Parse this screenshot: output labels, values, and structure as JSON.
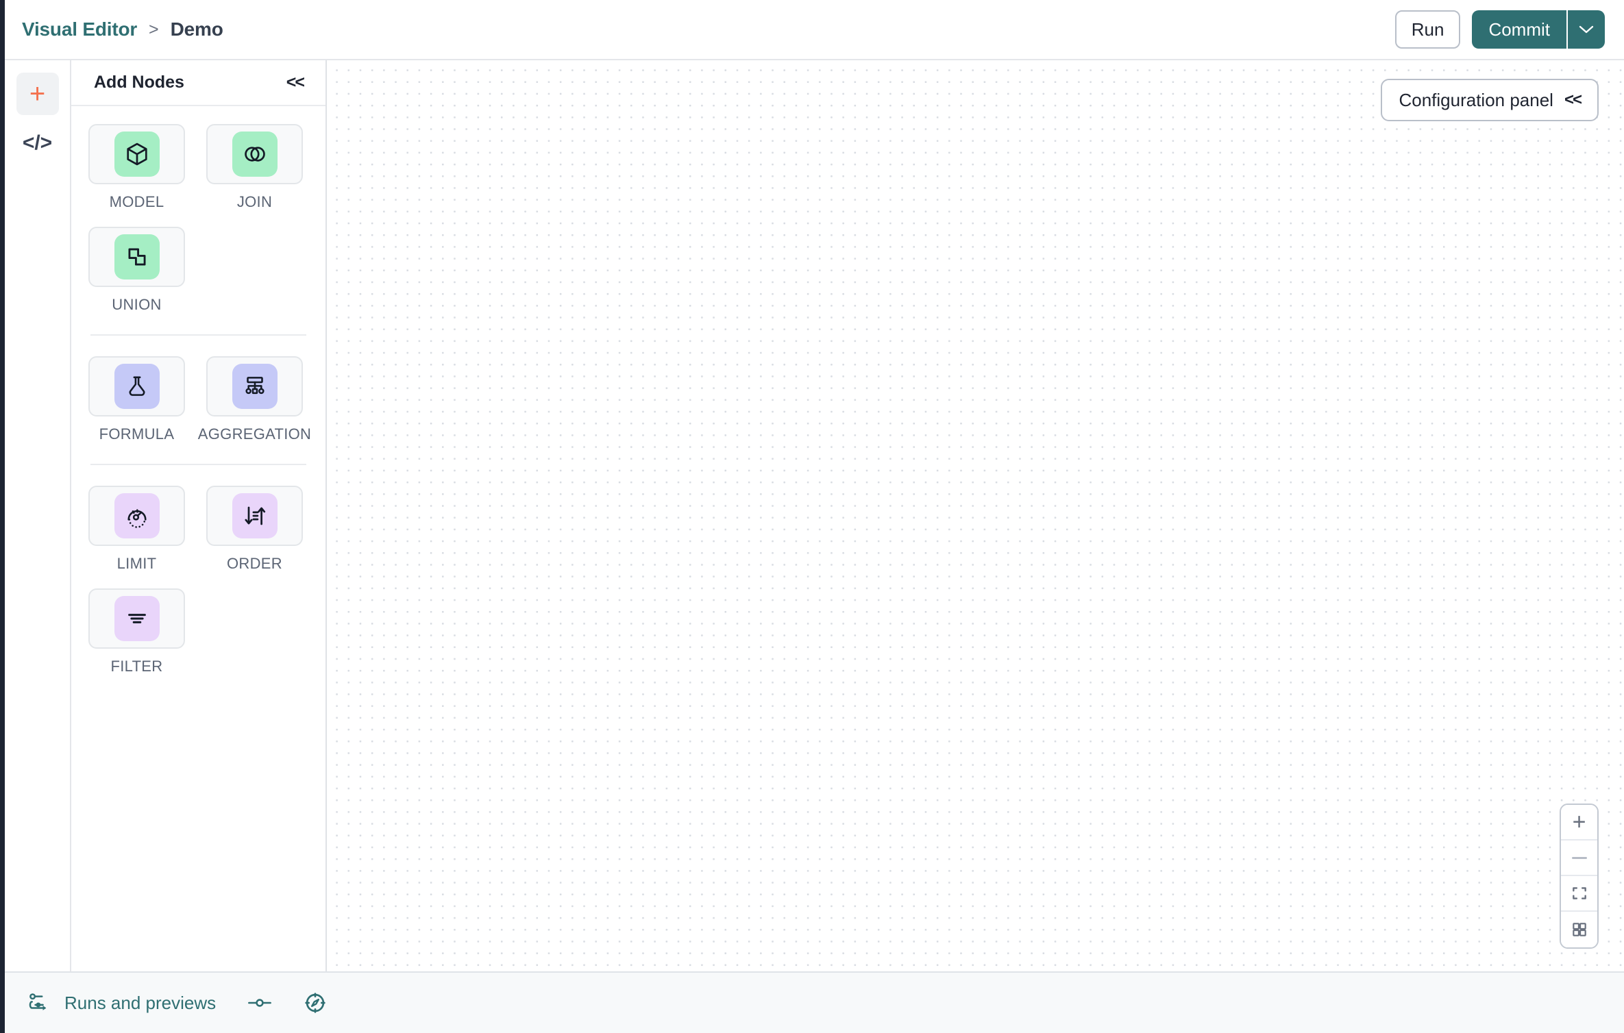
{
  "header": {
    "breadcrumb_root": "Visual Editor",
    "breadcrumb_separator": ">",
    "breadcrumb_current": "Demo",
    "run_label": "Run",
    "commit_label": "Commit",
    "commit_caret_icon": "chevron-down-icon"
  },
  "rail": {
    "add_icon": "plus-icon",
    "code_icon": "code-brackets-icon"
  },
  "nodes_panel": {
    "title": "Add Nodes",
    "collapse_icon": "<<",
    "groups": [
      {
        "id": "sources",
        "items": [
          {
            "label": "MODEL",
            "icon": "cube-icon",
            "color": "#a5eec4"
          },
          {
            "label": "JOIN",
            "icon": "venn-join-icon",
            "color": "#a5eec4"
          },
          {
            "label": "UNION",
            "icon": "union-shapes-icon",
            "color": "#a5eec4"
          }
        ]
      },
      {
        "id": "transforms",
        "items": [
          {
            "label": "FORMULA",
            "icon": "flask-icon",
            "color": "#c5c9f7"
          },
          {
            "label": "AGGREGATION",
            "icon": "hierarchy-icon",
            "color": "#c5c9f7"
          }
        ]
      },
      {
        "id": "modifiers",
        "items": [
          {
            "label": "LIMIT",
            "icon": "gauge-icon",
            "color": "#e9d5fa"
          },
          {
            "label": "ORDER",
            "icon": "sort-arrows-icon",
            "color": "#e9d5fa"
          },
          {
            "label": "FILTER",
            "icon": "filter-lines-icon",
            "color": "#e9d5fa"
          }
        ]
      }
    ]
  },
  "canvas": {
    "config_panel_label": "Configuration panel",
    "config_panel_collapse_icon": "<<",
    "zoom_controls": [
      {
        "name": "zoom-in",
        "icon": "plus-icon"
      },
      {
        "name": "zoom-out",
        "icon": "minus-icon"
      },
      {
        "name": "fit-view",
        "icon": "fit-screen-icon"
      },
      {
        "name": "grid-toggle",
        "icon": "grid-squares-icon"
      }
    ]
  },
  "bottombar": {
    "runs_label": "Runs and previews",
    "runs_icon": "flow-runs-icon",
    "slider_icon": "slider-handle-icon",
    "compass_icon": "compass-icon"
  },
  "colors": {
    "brand_teal": "#2f6f72",
    "accent_orange": "#f4714e",
    "green_swatch": "#a5eec4",
    "periwinkle_swatch": "#c5c9f7",
    "lilac_swatch": "#e9d5fa",
    "rail_dark": "#1d2433"
  }
}
